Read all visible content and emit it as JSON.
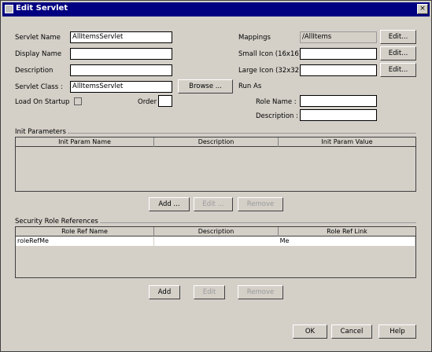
{
  "window": {
    "title": "Edit Servlet",
    "close_symbol": "×"
  },
  "form": {
    "servlet_name": {
      "label": "Servlet Name",
      "value": "AllItemsServlet"
    },
    "display_name": {
      "label": "Display Name",
      "value": ""
    },
    "description": {
      "label": "Description",
      "value": ""
    },
    "servlet_class": {
      "label": "Servlet Class :",
      "value": "AllItemsServlet",
      "browse": "Browse ..."
    },
    "load_on_startup": {
      "label": "Load On Startup",
      "order_label": "Order"
    },
    "mappings": {
      "label": "Mappings",
      "value": "/AllItems",
      "edit": "Edit..."
    },
    "small_icon": {
      "label": "Small Icon (16x16)",
      "edit": "Edit..."
    },
    "large_icon": {
      "label": "Large Icon (32x32)",
      "edit": "Edit..."
    },
    "run_as": {
      "label": "Run As",
      "role_name_label": "Role Name :",
      "description_label": "Description :"
    }
  },
  "init_params": {
    "title": "Init Parameters",
    "columns": [
      "Init Param Name",
      "Description",
      "Init Param Value"
    ],
    "buttons": {
      "add": "Add ...",
      "edit": "Edit ...",
      "remove": "Remove"
    }
  },
  "security_roles": {
    "title": "Security Role References",
    "columns": [
      "Role Ref Name",
      "Description",
      "Role Ref Link"
    ],
    "rows": [
      {
        "name": "roleRefMe",
        "link": "Me"
      }
    ],
    "buttons": {
      "add": "Add",
      "edit": "Edit",
      "remove": "Remove"
    }
  },
  "footer": {
    "ok": "OK",
    "cancel": "Cancel",
    "help": "Help"
  }
}
